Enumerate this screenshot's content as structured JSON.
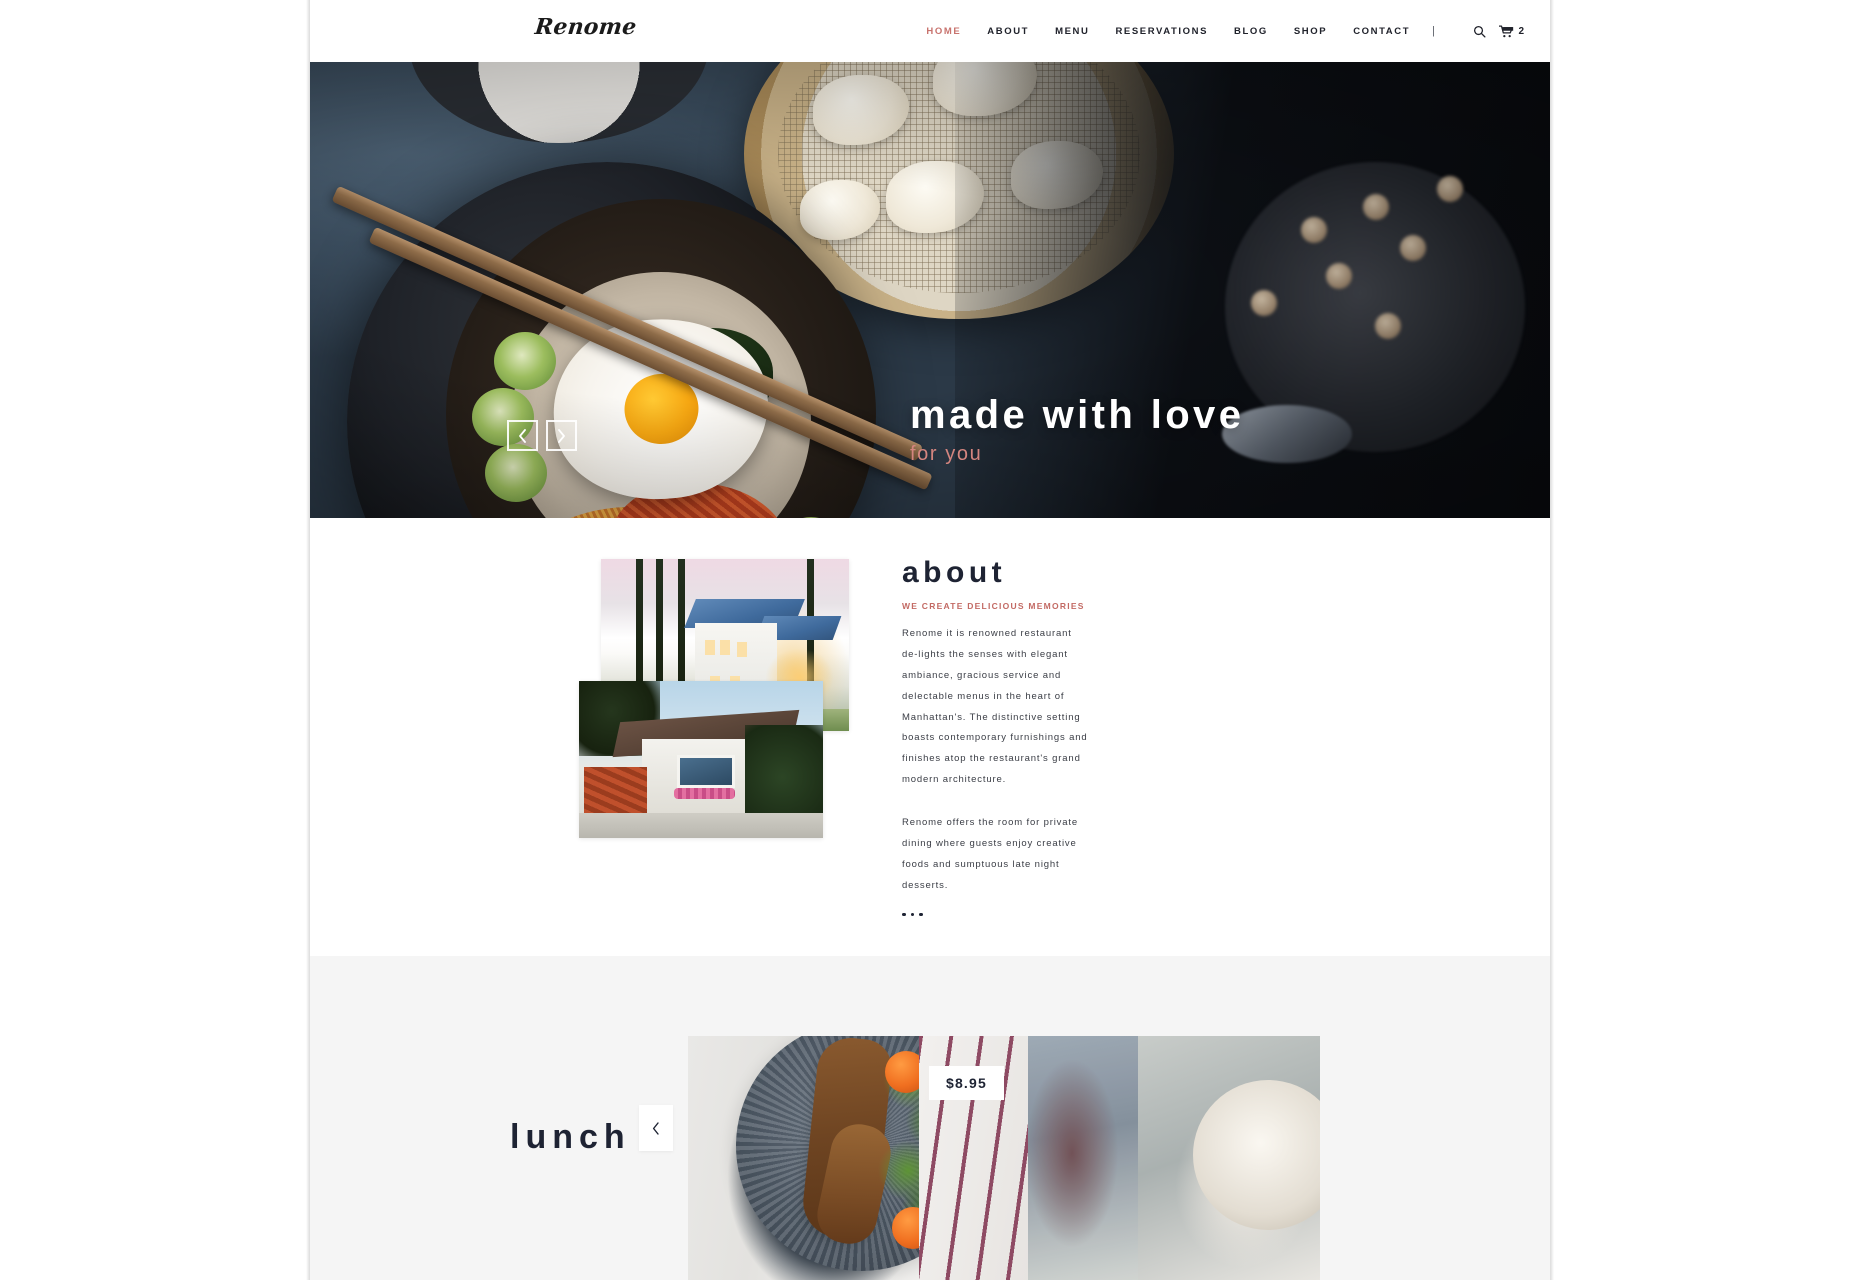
{
  "header": {
    "logo": "Renome",
    "nav": [
      {
        "label": "HOME",
        "active": true
      },
      {
        "label": "ABOUT",
        "active": false
      },
      {
        "label": "MENU",
        "active": false
      },
      {
        "label": "RESERVATIONS",
        "active": false
      },
      {
        "label": "BLOG",
        "active": false
      },
      {
        "label": "SHOP",
        "active": false
      },
      {
        "label": "CONTACT",
        "active": false
      }
    ],
    "separator": "|",
    "search_icon": "search-icon",
    "cart_icon": "cart-icon",
    "cart_count": "2"
  },
  "hero": {
    "title": "made with love",
    "subtitle": "for you",
    "prev_label": "‹",
    "next_label": "›",
    "image_alt": "bibimbap bowl with fried egg and chopsticks"
  },
  "about": {
    "heading": "about",
    "kicker": "WE CREATE DELICIOUS MEMORIES",
    "paragraph1": "Renome it is renowned restaurant de-lights the senses with elegant ambiance, gracious service and delectable menus in the heart of Manhattan's. The distinctive setting boasts contemporary furnishings and finishes atop the restaurant's grand modern architecture.",
    "paragraph2": "Renome offers the room for private dining where guests enjoy creative foods and sumptuous late night desserts.",
    "image1_alt": "white villa with blue roof at dusk",
    "image2_alt": "stucco house facade with flower box"
  },
  "lunch": {
    "heading": "lunch",
    "prev_label": "‹",
    "price": "$8.95",
    "slide1_alt": "seeded bread with arugula salad on dark plate",
    "slide2_alt": "food plate",
    "slide3_alt": "white bowl on table"
  },
  "colors": {
    "accent": "#c8736e",
    "heading": "#1e2333",
    "body_text": "#3a3d45",
    "section_bg": "#f5f5f5",
    "page_bg": "#ffffff"
  }
}
